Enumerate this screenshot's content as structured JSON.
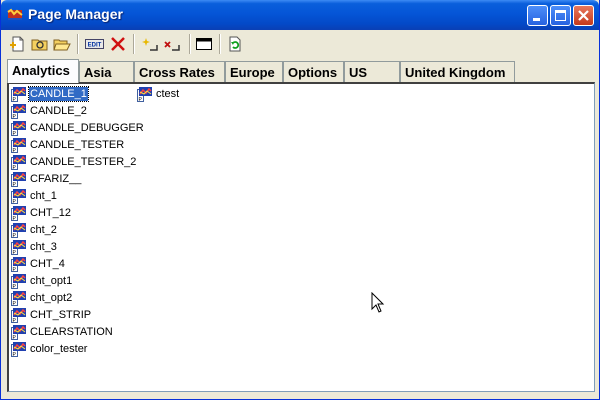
{
  "window": {
    "title": "Page Manager",
    "controls": {
      "minimize": "minimize",
      "maximize": "maximize",
      "close": "close"
    }
  },
  "toolbar": {
    "buttons": [
      {
        "name": "new-page-icon"
      },
      {
        "name": "open-page-icon"
      },
      {
        "name": "open-folder-icon"
      },
      {
        "name": "edit-icon",
        "label": "EDIT"
      },
      {
        "name": "delete-icon"
      },
      {
        "name": "new-item-icon"
      },
      {
        "name": "rename-icon"
      },
      {
        "name": "window-icon"
      },
      {
        "name": "refresh-icon"
      }
    ]
  },
  "tabs": [
    {
      "label": "Analytics",
      "active": true
    },
    {
      "label": "Asia"
    },
    {
      "label": "Cross Rates"
    },
    {
      "label": "Europe"
    },
    {
      "label": "Options"
    },
    {
      "label": "US"
    },
    {
      "label": "United Kingdom"
    }
  ],
  "pages": {
    "column1": [
      "CANDLE_1",
      "CANDLE_2",
      "CANDLE_DEBUGGER",
      "CANDLE_TESTER",
      "CANDLE_TESTER_2",
      "CFARIZ__",
      "cht_1",
      "CHT_12",
      "cht_2",
      "cht_3",
      "CHT_4",
      "cht_opt1",
      "cht_opt2",
      "CHT_STRIP",
      "CLEARSTATION",
      "color_tester"
    ],
    "column2": [
      "ctest"
    ],
    "selected": "CANDLE_1"
  },
  "colors": {
    "titlebar": "#0555d7",
    "selection": "#316ac5",
    "face": "#ece9d8"
  },
  "icons": {
    "page": "page-doc-icon",
    "app": "app-icon"
  }
}
